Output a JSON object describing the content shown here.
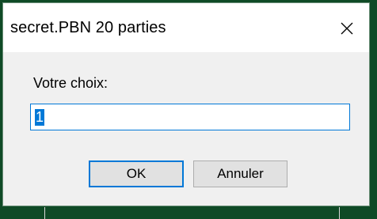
{
  "window": {
    "title": "secret.PBN 20 parties"
  },
  "prompt": {
    "label": "Votre choix:"
  },
  "input": {
    "value": "1"
  },
  "buttons": {
    "ok_label": "OK",
    "cancel_label": "Annuler"
  },
  "icons": {
    "close": "close-icon"
  },
  "colors": {
    "accent": "#0078d7",
    "background": "#0f4a26",
    "dialog": "#f0f0f0",
    "titlebar": "#ffffff"
  }
}
